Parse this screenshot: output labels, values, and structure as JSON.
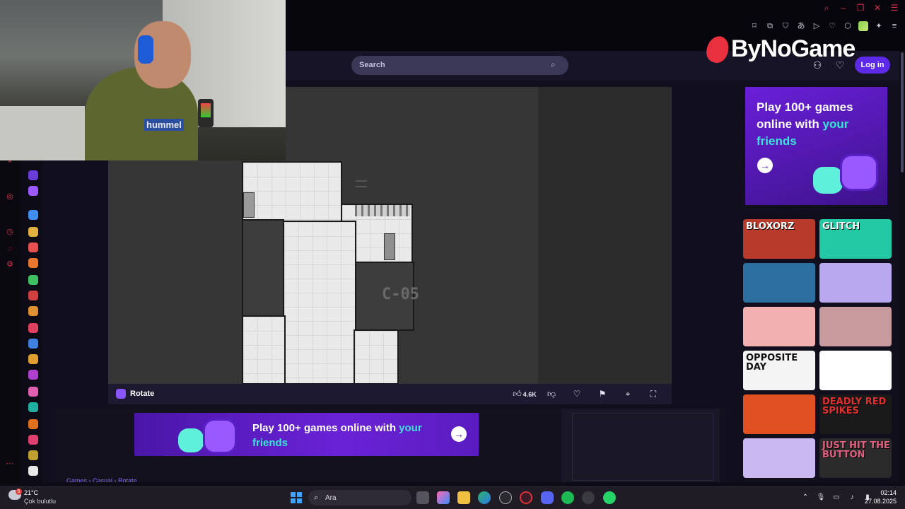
{
  "site": {
    "logo_text": "ByNoGame",
    "search_placeholder": "Search",
    "login_label": "Log in"
  },
  "game": {
    "title": "Rotate",
    "level_label": "C-05",
    "likes": "4.6K"
  },
  "ads": {
    "right_line1": "Play 100+ games",
    "right_line2": "online with ",
    "right_highlight": "your friends",
    "banner_line1_a": "Play 100+ games online with ",
    "banner_line1_b": "your",
    "banner_line2": "friends"
  },
  "thumbnails": [
    {
      "label": "BLOXORZ",
      "bg": "#b83a2a"
    },
    {
      "label": "GLITCH",
      "bg": "#22c9a4"
    },
    {
      "label": "",
      "bg": "#2a6fa0"
    },
    {
      "label": "",
      "bg": "#b9a8f0"
    },
    {
      "label": "",
      "bg": "#f2b0b0"
    },
    {
      "label": "",
      "bg": "#c79a9e"
    },
    {
      "label": "OPPOSITE DAY",
      "bg": "#f4f4f4"
    },
    {
      "label": "",
      "bg": "#ffffff"
    },
    {
      "label": "",
      "bg": "#e05020"
    },
    {
      "label": "DEADLY RED SPIKES",
      "bg": "#1a1a1a"
    },
    {
      "label": "",
      "bg": "#c9b8f2"
    },
    {
      "label": "JUST HIT THE BUTTON",
      "bg": "#2a2a2a"
    }
  ],
  "breadcrumb": "Games › Casual › Rotate",
  "taskbar": {
    "temperature": "21°C",
    "weather": "Çok bulutlu",
    "search_label": "Ara",
    "time": "02:14",
    "date": "27.08.2025",
    "weather_badge": "6"
  },
  "webcam": {
    "shirt_text": "hummel"
  }
}
